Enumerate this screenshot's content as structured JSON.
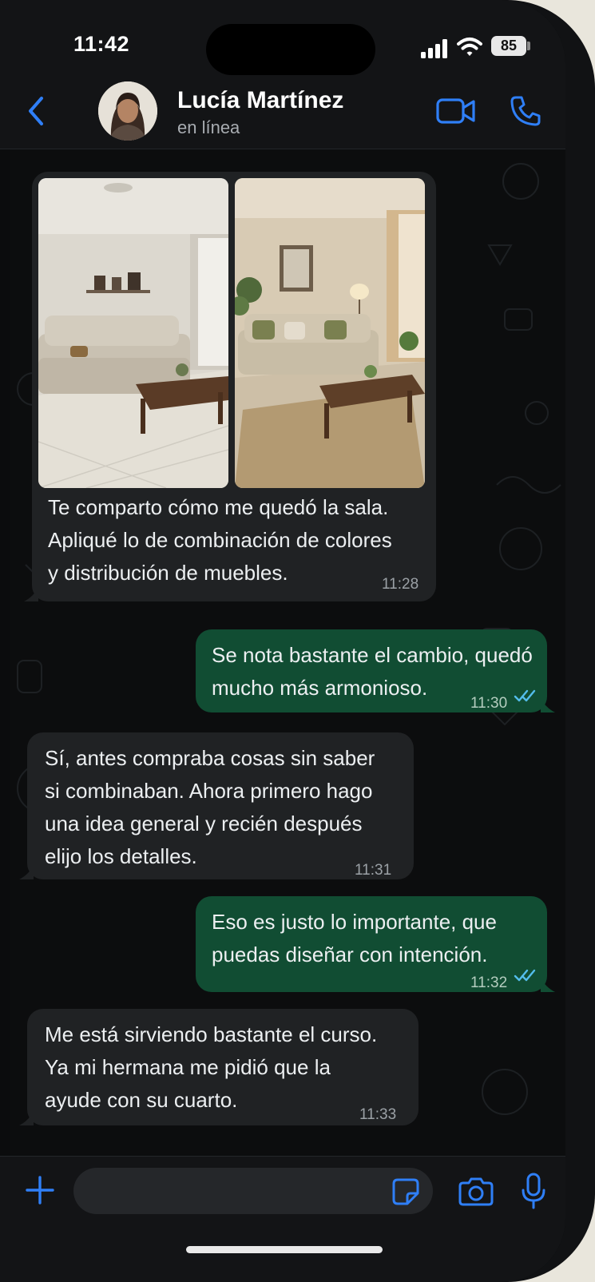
{
  "status_bar": {
    "time": "11:42",
    "battery": "85",
    "icons": [
      "signal-icon",
      "wifi-icon",
      "battery-icon"
    ]
  },
  "header": {
    "contact_name": "Lucía Martínez",
    "contact_status": "en línea",
    "icons": [
      "back-icon",
      "avatar",
      "video-call-icon",
      "phone-call-icon"
    ],
    "accent_color": "#2f7ff7"
  },
  "messages": [
    {
      "direction": "incoming",
      "type": "image-album",
      "images": [
        "living-room-before-photo",
        "living-room-after-photo"
      ],
      "text": "Te comparto cómo me quedó la sala.\nApliqué lo de combinación de colores\ny distribución de muebles.",
      "time": "11:28"
    },
    {
      "direction": "outgoing",
      "text": "Se nota bastante el cambio, quedó\nmucho más armonioso.",
      "time": "11:30",
      "status": "read"
    },
    {
      "direction": "incoming",
      "text": "Sí, antes compraba cosas sin saber\nsi combinaban. Ahora primero hago\nuna idea general y recién después\nelijo los detalles.",
      "time": "11:31"
    },
    {
      "direction": "outgoing",
      "text": "Eso es justo lo importante, que\npuedas diseñar con intención.",
      "time": "11:32",
      "status": "read"
    },
    {
      "direction": "incoming",
      "text": "Me está sirviendo bastante el curso.\nYa mi hermana me pidió que la\nayude con su cuarto.",
      "time": "11:33"
    }
  ],
  "input_bar": {
    "placeholder": "",
    "icons": [
      "plus-icon",
      "sticker-icon",
      "camera-icon",
      "microphone-icon"
    ]
  },
  "colors": {
    "incoming_bubble": "#202224",
    "outgoing_bubble": "#114d33",
    "read_ticks": "#53bdeb",
    "background": "#0c0d0e"
  }
}
